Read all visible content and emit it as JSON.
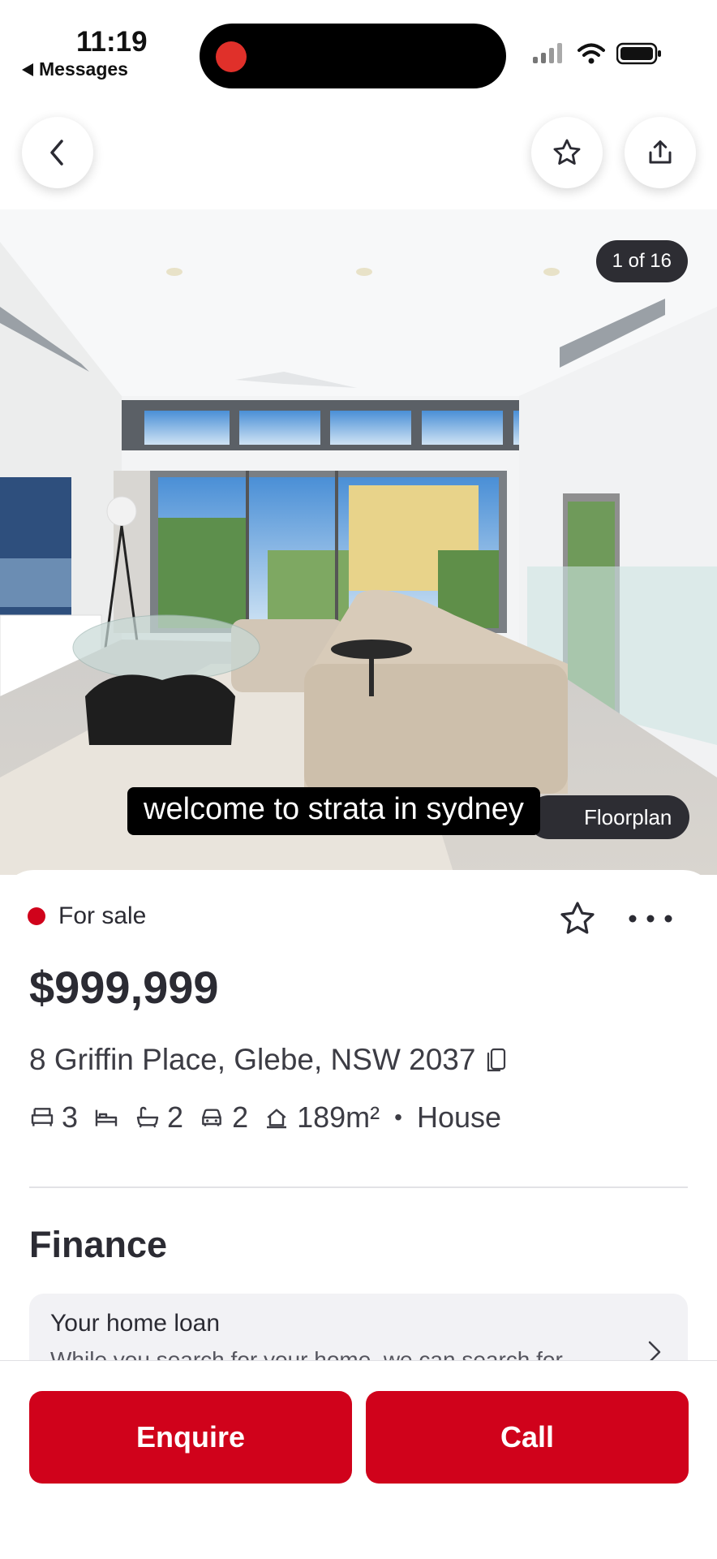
{
  "status_bar": {
    "time": "11:19",
    "back_app": "Messages"
  },
  "gallery": {
    "counter": "1 of 16",
    "floorplan_label": "Floorplan",
    "caption": "welcome to strata in sydney"
  },
  "listing": {
    "status": "For sale",
    "price": "$999,999",
    "address": "8 Griffin Place, Glebe, NSW 2037",
    "features": {
      "bedrooms": "3",
      "bathrooms": "2",
      "parking": "2",
      "land_size": "189m²",
      "separator": "•",
      "property_type": "House"
    }
  },
  "finance": {
    "heading": "Finance",
    "card_title": "Your home loan",
    "card_text": "While you search for your home, we can search for"
  },
  "actions": {
    "enquire": "Enquire",
    "call": "Call"
  },
  "colors": {
    "brand_red": "#d0021b",
    "text_dark": "#2b2b33",
    "pill_dark": "#2d2d33"
  },
  "icons": [
    "back-icon",
    "star-icon",
    "share-icon",
    "copy-icon",
    "bed-icon",
    "study-icon",
    "bath-icon",
    "car-icon",
    "land-size-icon",
    "more-icon",
    "chevron-right-icon"
  ]
}
